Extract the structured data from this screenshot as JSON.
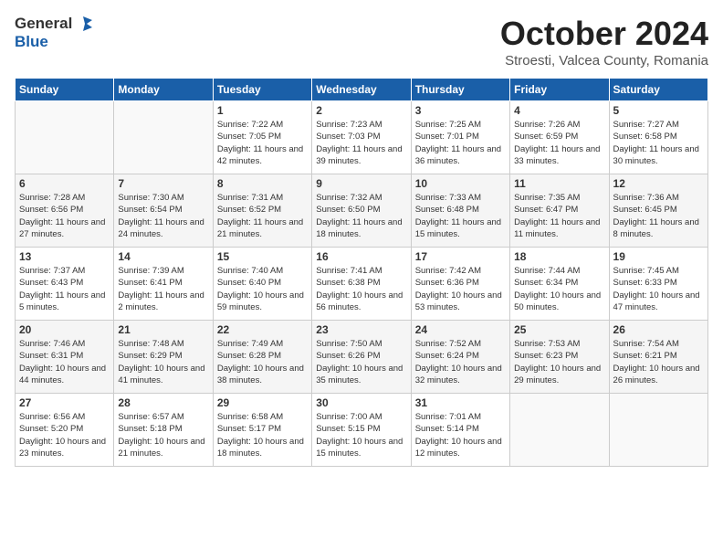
{
  "header": {
    "logo_general": "General",
    "logo_blue": "Blue",
    "month_title": "October 2024",
    "location": "Stroesti, Valcea County, Romania"
  },
  "days_of_week": [
    "Sunday",
    "Monday",
    "Tuesday",
    "Wednesday",
    "Thursday",
    "Friday",
    "Saturday"
  ],
  "weeks": [
    [
      {
        "day": "",
        "info": ""
      },
      {
        "day": "",
        "info": ""
      },
      {
        "day": "1",
        "info": "Sunrise: 7:22 AM\nSunset: 7:05 PM\nDaylight: 11 hours and 42 minutes."
      },
      {
        "day": "2",
        "info": "Sunrise: 7:23 AM\nSunset: 7:03 PM\nDaylight: 11 hours and 39 minutes."
      },
      {
        "day": "3",
        "info": "Sunrise: 7:25 AM\nSunset: 7:01 PM\nDaylight: 11 hours and 36 minutes."
      },
      {
        "day": "4",
        "info": "Sunrise: 7:26 AM\nSunset: 6:59 PM\nDaylight: 11 hours and 33 minutes."
      },
      {
        "day": "5",
        "info": "Sunrise: 7:27 AM\nSunset: 6:58 PM\nDaylight: 11 hours and 30 minutes."
      }
    ],
    [
      {
        "day": "6",
        "info": "Sunrise: 7:28 AM\nSunset: 6:56 PM\nDaylight: 11 hours and 27 minutes."
      },
      {
        "day": "7",
        "info": "Sunrise: 7:30 AM\nSunset: 6:54 PM\nDaylight: 11 hours and 24 minutes."
      },
      {
        "day": "8",
        "info": "Sunrise: 7:31 AM\nSunset: 6:52 PM\nDaylight: 11 hours and 21 minutes."
      },
      {
        "day": "9",
        "info": "Sunrise: 7:32 AM\nSunset: 6:50 PM\nDaylight: 11 hours and 18 minutes."
      },
      {
        "day": "10",
        "info": "Sunrise: 7:33 AM\nSunset: 6:48 PM\nDaylight: 11 hours and 15 minutes."
      },
      {
        "day": "11",
        "info": "Sunrise: 7:35 AM\nSunset: 6:47 PM\nDaylight: 11 hours and 11 minutes."
      },
      {
        "day": "12",
        "info": "Sunrise: 7:36 AM\nSunset: 6:45 PM\nDaylight: 11 hours and 8 minutes."
      }
    ],
    [
      {
        "day": "13",
        "info": "Sunrise: 7:37 AM\nSunset: 6:43 PM\nDaylight: 11 hours and 5 minutes."
      },
      {
        "day": "14",
        "info": "Sunrise: 7:39 AM\nSunset: 6:41 PM\nDaylight: 11 hours and 2 minutes."
      },
      {
        "day": "15",
        "info": "Sunrise: 7:40 AM\nSunset: 6:40 PM\nDaylight: 10 hours and 59 minutes."
      },
      {
        "day": "16",
        "info": "Sunrise: 7:41 AM\nSunset: 6:38 PM\nDaylight: 10 hours and 56 minutes."
      },
      {
        "day": "17",
        "info": "Sunrise: 7:42 AM\nSunset: 6:36 PM\nDaylight: 10 hours and 53 minutes."
      },
      {
        "day": "18",
        "info": "Sunrise: 7:44 AM\nSunset: 6:34 PM\nDaylight: 10 hours and 50 minutes."
      },
      {
        "day": "19",
        "info": "Sunrise: 7:45 AM\nSunset: 6:33 PM\nDaylight: 10 hours and 47 minutes."
      }
    ],
    [
      {
        "day": "20",
        "info": "Sunrise: 7:46 AM\nSunset: 6:31 PM\nDaylight: 10 hours and 44 minutes."
      },
      {
        "day": "21",
        "info": "Sunrise: 7:48 AM\nSunset: 6:29 PM\nDaylight: 10 hours and 41 minutes."
      },
      {
        "day": "22",
        "info": "Sunrise: 7:49 AM\nSunset: 6:28 PM\nDaylight: 10 hours and 38 minutes."
      },
      {
        "day": "23",
        "info": "Sunrise: 7:50 AM\nSunset: 6:26 PM\nDaylight: 10 hours and 35 minutes."
      },
      {
        "day": "24",
        "info": "Sunrise: 7:52 AM\nSunset: 6:24 PM\nDaylight: 10 hours and 32 minutes."
      },
      {
        "day": "25",
        "info": "Sunrise: 7:53 AM\nSunset: 6:23 PM\nDaylight: 10 hours and 29 minutes."
      },
      {
        "day": "26",
        "info": "Sunrise: 7:54 AM\nSunset: 6:21 PM\nDaylight: 10 hours and 26 minutes."
      }
    ],
    [
      {
        "day": "27",
        "info": "Sunrise: 6:56 AM\nSunset: 5:20 PM\nDaylight: 10 hours and 23 minutes."
      },
      {
        "day": "28",
        "info": "Sunrise: 6:57 AM\nSunset: 5:18 PM\nDaylight: 10 hours and 21 minutes."
      },
      {
        "day": "29",
        "info": "Sunrise: 6:58 AM\nSunset: 5:17 PM\nDaylight: 10 hours and 18 minutes."
      },
      {
        "day": "30",
        "info": "Sunrise: 7:00 AM\nSunset: 5:15 PM\nDaylight: 10 hours and 15 minutes."
      },
      {
        "day": "31",
        "info": "Sunrise: 7:01 AM\nSunset: 5:14 PM\nDaylight: 10 hours and 12 minutes."
      },
      {
        "day": "",
        "info": ""
      },
      {
        "day": "",
        "info": ""
      }
    ]
  ]
}
